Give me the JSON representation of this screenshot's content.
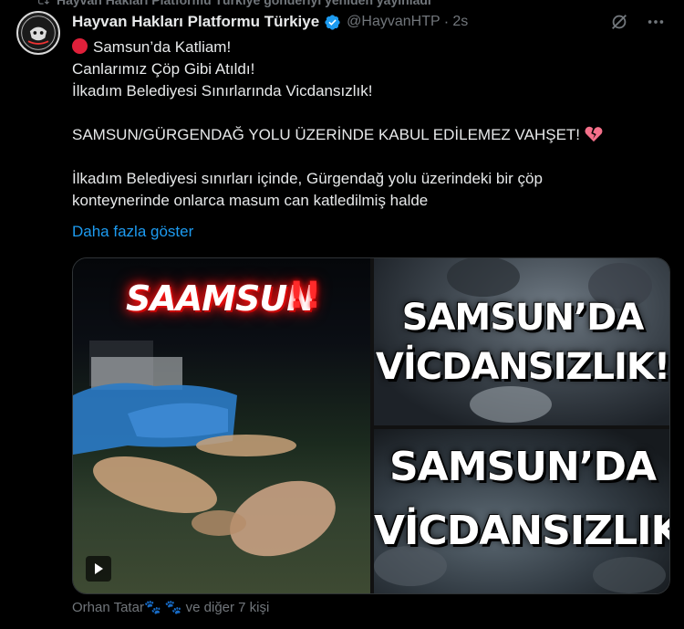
{
  "repost": {
    "text": "Hayvan Hakları Platformu Türkiye gönderiyi yeniden yayınladı"
  },
  "tweet": {
    "author_name": "Hayvan Hakları Platformu Türkiye",
    "handle": "@HayvanHTP",
    "separator": "·",
    "time": "2s",
    "lines": [
      "Samsun’da Katliam!",
      "Canlarımız Çöp Gibi Atıldı!",
      "İlkadım Belediyesi Sınırlarında Vicdansızlık!",
      "SAMSUN/GÜRGENDAĞ YOLU ÜZERİNDE KABUL EDİLEMEZ VAHŞET!",
      "İlkadım Belediyesi sınırları içinde, Gürgendağ yolu üzerindeki bir çöp",
      "konteynerinde onlarca masum can katledilmiş halde"
    ],
    "show_more": "Daha fazla göster",
    "icons": {
      "verified": "verified-badge-icon",
      "grok": "grok-icon",
      "more": "more-options-icon",
      "red_circle": "red-circle-emoji",
      "broken_heart": "broken-heart-emoji"
    }
  },
  "media": {
    "left_overlay_word": "SAAMSUN",
    "left_overlay_bangs": "!!",
    "right_top_line1": "SAMSUN’DA",
    "right_top_line2": "VİCDANSIZLIK!",
    "right_bottom_line1": "SAMSUN’DA",
    "right_bottom_line2": "VİCDANSIZLIK!"
  },
  "likes": {
    "name": "Orhan Tatar",
    "paws": "🐾 🐾",
    "others": "ve diğer 7 kişi"
  },
  "colors": {
    "background": "#000000",
    "text": "#e7e9ea",
    "muted": "#71767b",
    "link": "#1d9bf0",
    "verified": "#1d9bf0"
  }
}
